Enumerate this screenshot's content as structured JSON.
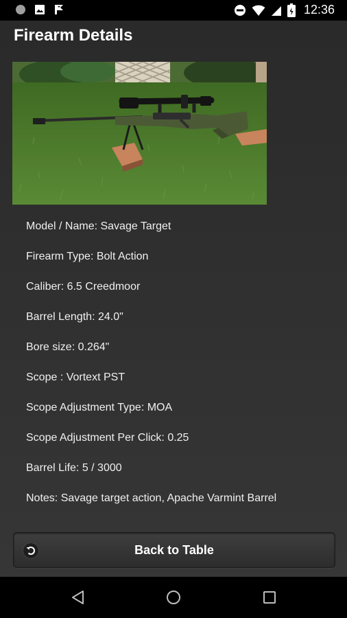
{
  "status_bar": {
    "time": "12:36",
    "icons": [
      "circle-notification-icon",
      "image-notification-icon",
      "flag-notification-icon",
      "do-not-disturb-icon",
      "wifi-icon",
      "signal-icon",
      "battery-icon"
    ]
  },
  "page": {
    "title": "Firearm Details"
  },
  "photo": {
    "subject": "rifle-photo"
  },
  "details": [
    {
      "label": "Model / Name",
      "sep": ": ",
      "value": "Savage Target"
    },
    {
      "label": "Firearm Type",
      "sep": ": ",
      "value": "Bolt Action"
    },
    {
      "label": "Caliber",
      "sep": ": ",
      "value": "6.5 Creedmoor"
    },
    {
      "label": "Barrel Length",
      "sep": ": ",
      "value": "24.0\""
    },
    {
      "label": "Bore size",
      "sep": ": ",
      "value": "0.264\""
    },
    {
      "label": "Scope",
      "sep": " : ",
      "value": "Vortext PST"
    },
    {
      "label": "Scope Adjustment Type",
      "sep": ": ",
      "value": "MOA"
    },
    {
      "label": "Scope Adjustment Per Click",
      "sep": ": ",
      "value": "0.25"
    },
    {
      "label": "Barrel Life",
      "sep": ": ",
      "value": "5 / 3000"
    },
    {
      "label": "Notes",
      "sep": ": ",
      "value": "Savage target action, Apache Varmint Barrel"
    }
  ],
  "back_button": {
    "label": "Back to Table",
    "icon": "back-arrow-icon"
  },
  "nav_bar": {
    "buttons": [
      "back-triangle-icon",
      "home-circle-icon",
      "recents-square-icon"
    ]
  },
  "colors": {
    "background": "#2f2f2f",
    "text": "#ffffff",
    "button": "#363636",
    "grass": "#4d7a2e",
    "stock": "#4b5a35"
  }
}
